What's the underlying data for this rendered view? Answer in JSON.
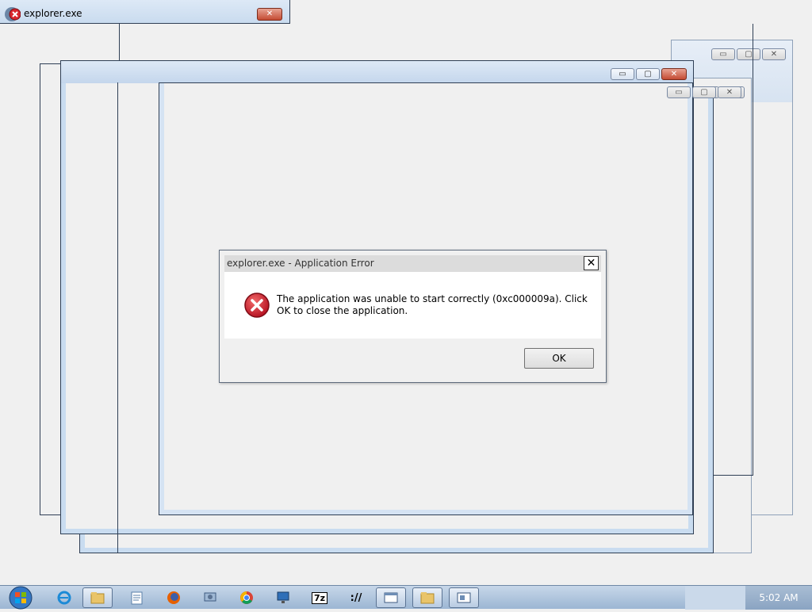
{
  "top_window": {
    "title": "explorer.exe"
  },
  "background_windows": {
    "minimize_glyph": "▭",
    "maximize_glyph": "▢",
    "close_glyph": "✕"
  },
  "dialog": {
    "title": "explorer.exe - Application Error",
    "close_glyph": "✕",
    "message": "The application was unable to start correctly (0xc000009a). Click OK to close the application.",
    "ok_label": "OK",
    "icon": "error-icon"
  },
  "taskbar": {
    "start_icon": "windows-orb-icon",
    "items": [
      {
        "icon": "internet-explorer-icon"
      },
      {
        "icon": "file-explorer-icon"
      },
      {
        "icon": "notepad-icon"
      },
      {
        "icon": "firefox-icon"
      },
      {
        "icon": "network-tool-icon"
      },
      {
        "icon": "chrome-icon"
      },
      {
        "icon": "remote-desktop-icon"
      },
      {
        "icon": "7zip-icon",
        "label": "7z"
      },
      {
        "icon": "terminal-icon",
        "label": "://"
      },
      {
        "icon": "window-icon"
      },
      {
        "icon": "folder-icon"
      },
      {
        "icon": "app-window-icon"
      }
    ],
    "clock": "5:02 AM"
  },
  "colors": {
    "error_red": "#c8102e",
    "titlebar_blue": "#c9dbef",
    "taskbar_blue": "#9cb6d3"
  }
}
